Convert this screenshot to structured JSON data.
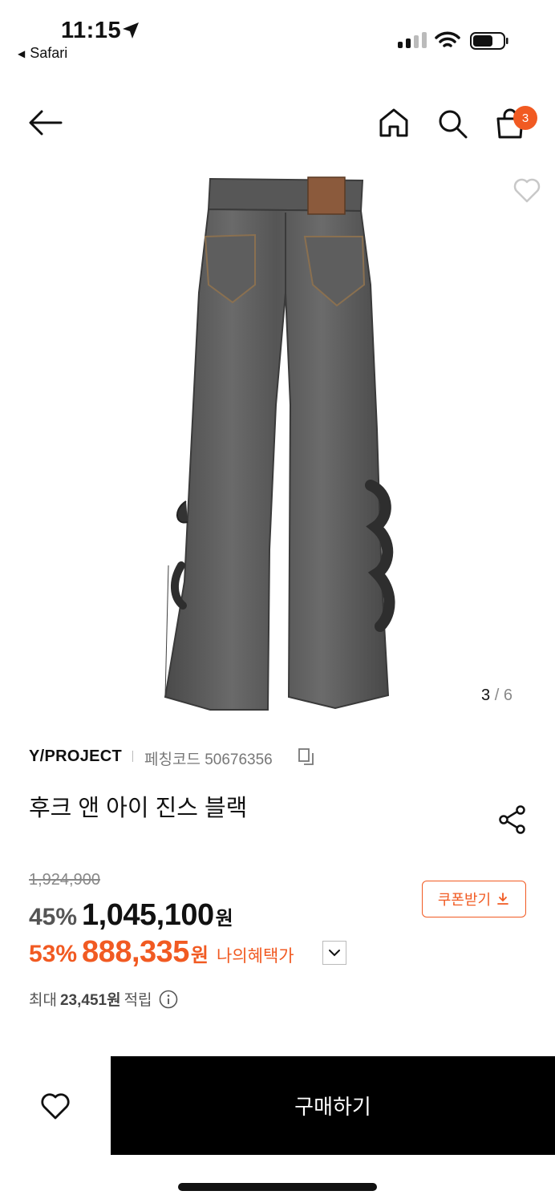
{
  "status_bar": {
    "time": "11:15",
    "back_app": "Safari",
    "back_glyph": "◀"
  },
  "header": {
    "cart_count": "3",
    "icons": [
      "back-arrow-icon",
      "home-icon",
      "search-icon",
      "shopping-bag-icon"
    ]
  },
  "gallery": {
    "current": "3",
    "separator": "/",
    "total": "6"
  },
  "product": {
    "brand": "Y/PROJECT",
    "code_text": "페칭코드 50676356",
    "title": "후크 앤 아이 진스 블랙",
    "original_price": "1,924,900",
    "discount_pct": "45%",
    "price": "1,045,100",
    "currency": "원",
    "benefit_pct": "53%",
    "benefit_price": "888,335",
    "benefit_currency": "원",
    "benefit_label": "나의혜택가",
    "points_prefix": "최대",
    "points_amount": "23,451원",
    "points_suffix": "적립"
  },
  "coupon": {
    "label": "쿠폰받기"
  },
  "bottom_bar": {
    "buy_label": "구매하기"
  },
  "colors": {
    "accent": "#f15a22",
    "buy_button": "#000000",
    "denim": "#5a5a5a"
  }
}
